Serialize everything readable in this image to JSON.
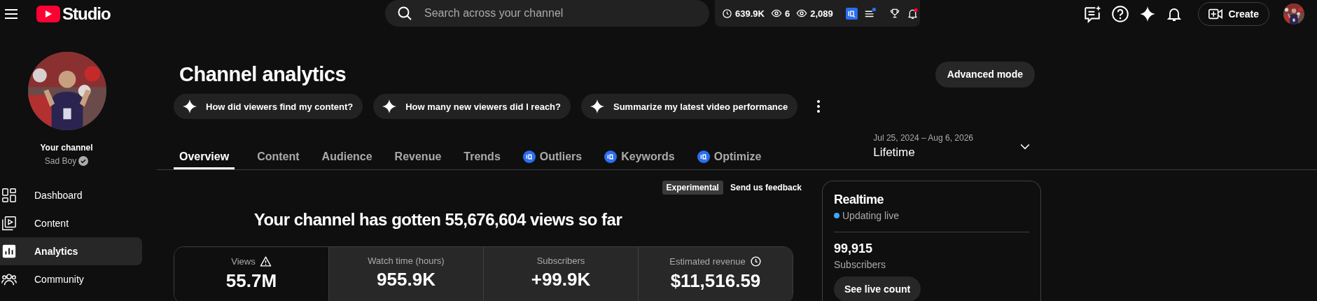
{
  "header": {
    "logo_text": "Studio",
    "search": {
      "placeholder": "Search across your channel"
    },
    "stats": [
      {
        "kind": "clock",
        "value": "639.9K"
      },
      {
        "kind": "eye",
        "value": "6"
      },
      {
        "kind": "eye",
        "value": "2,089"
      }
    ],
    "create_label": "Create"
  },
  "sidebar": {
    "channel_label": "Your channel",
    "channel_name": "Sad Boy",
    "verified": true,
    "items": [
      {
        "kind": "dashboard",
        "label": "Dashboard",
        "selected": false
      },
      {
        "kind": "content",
        "label": "Content",
        "selected": false
      },
      {
        "kind": "analytics",
        "label": "Analytics",
        "selected": true
      },
      {
        "kind": "community",
        "label": "Community",
        "selected": false
      }
    ]
  },
  "page": {
    "title": "Channel analytics",
    "advanced_mode": "Advanced mode",
    "prompts": [
      "How did viewers find my content?",
      "How many new viewers did I reach?",
      "Summarize my latest video performance"
    ],
    "tabs": [
      {
        "label": "Overview",
        "selected": true,
        "kind": "plain"
      },
      {
        "label": "Content",
        "selected": false,
        "kind": "plain"
      },
      {
        "label": "Audience",
        "selected": false,
        "kind": "plain"
      },
      {
        "label": "Revenue",
        "selected": false,
        "kind": "plain"
      },
      {
        "label": "Trends",
        "selected": false,
        "kind": "plain"
      },
      {
        "label": "Outliers",
        "selected": false,
        "kind": "extension"
      },
      {
        "label": "Keywords",
        "selected": false,
        "kind": "extension"
      },
      {
        "label": "Optimize",
        "selected": false,
        "kind": "extension"
      }
    ],
    "date_range": {
      "range": "Jul 25, 2024 – Aug 6, 2026",
      "label": "Lifetime"
    },
    "experimental_tag": "Experimental",
    "feedback_link": "Send us feedback",
    "headline": "Your channel has gotten 55,676,604 views so far",
    "metrics": [
      {
        "label": "Views",
        "value": "55.7M",
        "selected": true,
        "kind": "warning"
      },
      {
        "label": "Watch time (hours)",
        "value": "955.9K",
        "selected": false,
        "kind": "plain"
      },
      {
        "label": "Subscribers",
        "value": "+99.9K",
        "selected": false,
        "kind": "plain"
      },
      {
        "label": "Estimated revenue",
        "value": "$11,516.59",
        "selected": false,
        "kind": "clock"
      }
    ],
    "realtime": {
      "title": "Realtime",
      "status": "Updating live",
      "live": true,
      "count": "99,915",
      "count_label": "Subscribers",
      "button": "See live count"
    }
  }
}
